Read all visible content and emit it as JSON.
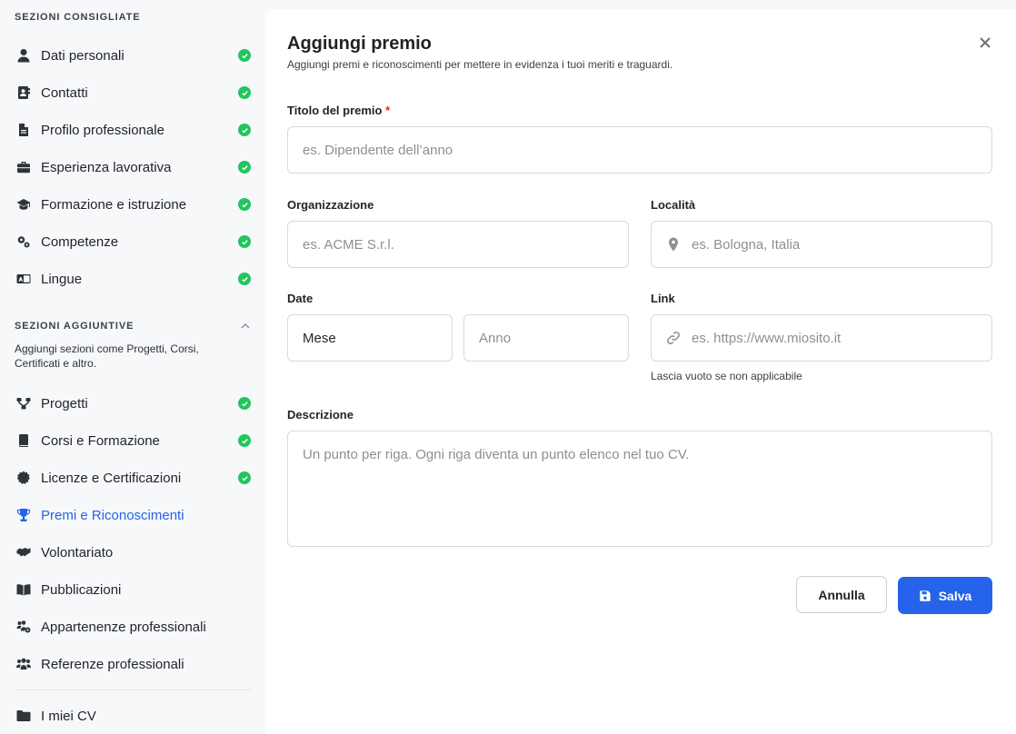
{
  "sidebar": {
    "recommended_heading": "SEZIONI CONSIGLIATE",
    "recommended": [
      {
        "label": "Dati personali",
        "icon": "user-icon",
        "done": true
      },
      {
        "label": "Contatti",
        "icon": "address-book-icon",
        "done": true
      },
      {
        "label": "Profilo professionale",
        "icon": "file-icon",
        "done": true
      },
      {
        "label": "Esperienza lavorativa",
        "icon": "briefcase-icon",
        "done": true
      },
      {
        "label": "Formazione e istruzione",
        "icon": "graduation-cap-icon",
        "done": true
      },
      {
        "label": "Competenze",
        "icon": "gears-icon",
        "done": true
      },
      {
        "label": "Lingue",
        "icon": "language-icon",
        "done": true
      }
    ],
    "additional_heading": "SEZIONI AGGIUNTIVE",
    "additional_desc": "Aggiungi sezioni come Progetti, Corsi, Certificati e altro.",
    "additional": [
      {
        "label": "Progetti",
        "icon": "diagram-icon",
        "done": true
      },
      {
        "label": "Corsi e Formazione",
        "icon": "book-icon",
        "done": true
      },
      {
        "label": "Licenze e Certificazioni",
        "icon": "certificate-icon",
        "done": true
      },
      {
        "label": "Premi e Riconoscimenti",
        "icon": "trophy-icon",
        "done": false,
        "active": true
      },
      {
        "label": "Volontariato",
        "icon": "handshake-icon",
        "done": false
      },
      {
        "label": "Pubblicazioni",
        "icon": "book-open-icon",
        "done": false
      },
      {
        "label": "Appartenenze professionali",
        "icon": "users-gear-icon",
        "done": false
      },
      {
        "label": "Referenze professionali",
        "icon": "users-icon",
        "done": false
      }
    ],
    "footer": {
      "label": "I miei CV",
      "icon": "folder-icon"
    }
  },
  "form": {
    "title": "Aggiungi premio",
    "subtitle": "Aggiungi premi e riconoscimenti per mettere in evidenza i tuoi meriti e traguardi.",
    "award_title": {
      "label": "Titolo del premio",
      "required_mark": "*",
      "placeholder": "es. Dipendente dell’anno"
    },
    "organization": {
      "label": "Organizzazione",
      "placeholder": "es. ACME S.r.l."
    },
    "location": {
      "label": "Località",
      "placeholder": "es. Bologna, Italia"
    },
    "date": {
      "label": "Date",
      "month_value": "Mese",
      "year_placeholder": "Anno"
    },
    "link": {
      "label": "Link",
      "placeholder": "es. https://www.miosito.it",
      "hint": "Lascia vuoto se non applicabile"
    },
    "description": {
      "label": "Descrizione",
      "placeholder": "Un punto per riga. Ogni riga diventa un punto elenco nel tuo CV."
    },
    "cancel_label": "Annulla",
    "save_label": "Salva"
  },
  "colors": {
    "accent": "#2563eb",
    "success": "#22c55e",
    "required": "#dc2626"
  }
}
